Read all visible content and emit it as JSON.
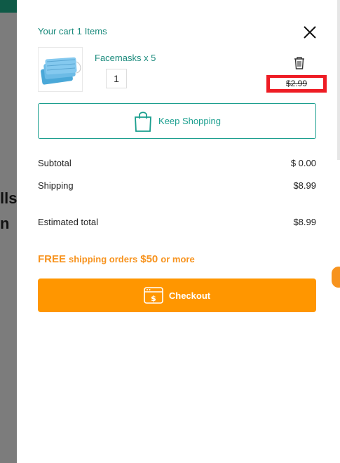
{
  "background": {
    "text_line_1": "lls",
    "text_line_2": "n"
  },
  "cart": {
    "header_prefix": "Your cart",
    "item_count": "1",
    "header_suffix": "Items",
    "close_icon": "close-icon"
  },
  "item": {
    "name": "Facemasks x 5",
    "quantity": "1",
    "price": "$2.99",
    "image_icon": "facemask-image",
    "delete_icon": "trash-icon"
  },
  "keep_shopping": {
    "label": "Keep Shopping",
    "icon": "shopping-bag-icon"
  },
  "summary": {
    "subtotal_label": "Subtotal",
    "subtotal_value": "$ 0.00",
    "shipping_label": "Shipping",
    "shipping_value": "$8.99",
    "estimated_label": "Estimated total",
    "estimated_value": "$8.99"
  },
  "promo": {
    "free": "FREE",
    "text1": "shipping orders",
    "amount": "$50",
    "text2": "or more"
  },
  "checkout": {
    "label": "Checkout",
    "icon": "payment-window-icon"
  },
  "colors": {
    "accent_teal": "#1a9e8e",
    "accent_orange": "#ff9600",
    "highlight_red": "#ee1c24"
  }
}
